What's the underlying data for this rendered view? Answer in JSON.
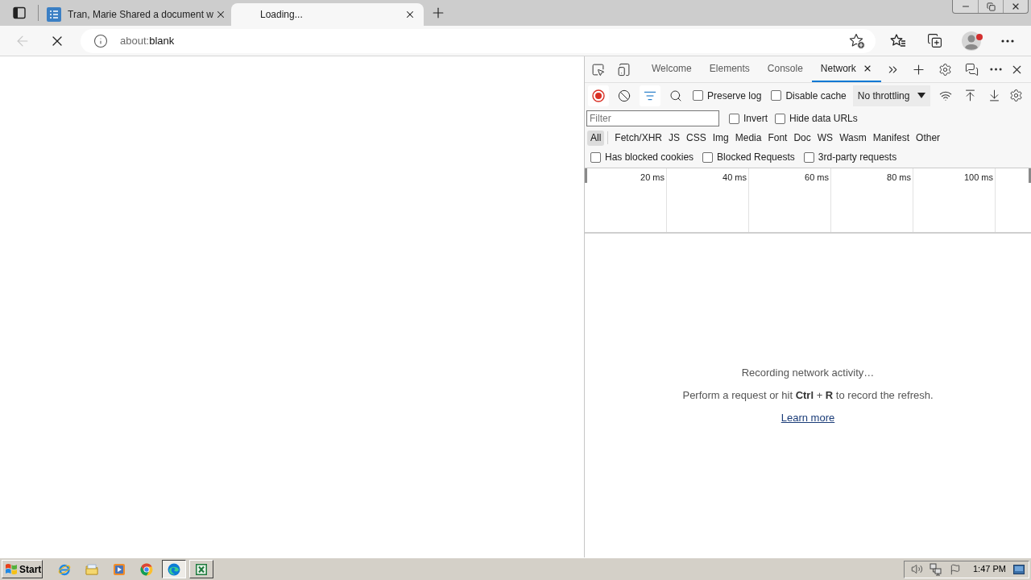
{
  "browser": {
    "tabs": [
      {
        "title": "Tran, Marie Shared a document w",
        "favicon": true,
        "selected": false
      },
      {
        "title": "Loading...",
        "favicon": false,
        "selected": true
      }
    ],
    "back_button": {
      "disabled": true
    },
    "url": "about:blank",
    "profile": {
      "notification": true
    }
  },
  "devtools": {
    "tabs": [
      {
        "label": "Welcome",
        "selected": false,
        "closable": false
      },
      {
        "label": "Elements",
        "selected": false,
        "closable": false
      },
      {
        "label": "Console",
        "selected": false,
        "closable": false
      },
      {
        "label": "Network",
        "selected": true,
        "closable": true
      }
    ],
    "toolbar": {
      "recording": true,
      "filter_on": true,
      "checkboxes": [
        {
          "label": "Preserve log",
          "checked": false
        },
        {
          "label": "Disable cache",
          "checked": false
        }
      ],
      "throttling": "No throttling"
    },
    "filter": {
      "placeholder": "Filter"
    },
    "filter_options": [
      {
        "label": "Invert",
        "checked": false
      },
      {
        "label": "Hide data URLs",
        "checked": false
      }
    ],
    "type_filters": [
      {
        "label": "All",
        "selected": true
      },
      {
        "label": "Fetch/XHR",
        "selected": false
      },
      {
        "label": "JS",
        "selected": false
      },
      {
        "label": "CSS",
        "selected": false
      },
      {
        "label": "Img",
        "selected": false
      },
      {
        "label": "Media",
        "selected": false
      },
      {
        "label": "Font",
        "selected": false
      },
      {
        "label": "Doc",
        "selected": false
      },
      {
        "label": "WS",
        "selected": false
      },
      {
        "label": "Wasm",
        "selected": false
      },
      {
        "label": "Manifest",
        "selected": false
      },
      {
        "label": "Other",
        "selected": false
      }
    ],
    "request_filters": [
      {
        "label": "Has blocked cookies",
        "checked": false
      },
      {
        "label": "Blocked Requests",
        "checked": false
      },
      {
        "label": "3rd-party requests",
        "checked": false
      }
    ],
    "timeline": {
      "ticks": [
        "20 ms",
        "40 ms",
        "60 ms",
        "80 ms",
        "100 ms"
      ]
    },
    "empty_state": {
      "title": "Recording network activity…",
      "hint": "Perform a request or hit **Ctrl** + **R** to record the refresh.",
      "link": "Learn more"
    }
  },
  "taskbar": {
    "start": "Start",
    "apps": [
      {
        "kind": "ie",
        "running": false,
        "selected": false
      },
      {
        "kind": "explorer",
        "running": false,
        "selected": false
      },
      {
        "kind": "media",
        "running": false,
        "selected": false
      },
      {
        "kind": "chrome",
        "running": false,
        "selected": false
      },
      {
        "kind": "edge",
        "running": true,
        "selected": true
      },
      {
        "kind": "excel",
        "running": true,
        "selected": false
      }
    ],
    "clock": "1:47 PM"
  }
}
